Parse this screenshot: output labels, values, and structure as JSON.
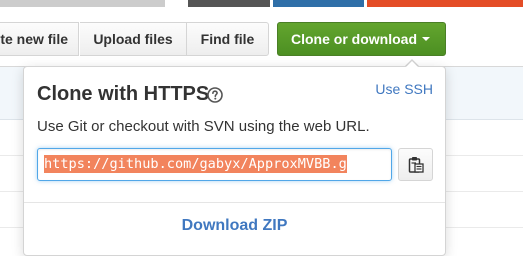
{
  "toolbar": {
    "create_new_file_label": "te new file",
    "upload_files_label": "Upload files",
    "find_file_label": "Find file",
    "clone_or_download_label": "Clone or download"
  },
  "clone_panel": {
    "title": "Clone with HTTPS",
    "help_icon": "question-circle-icon",
    "use_ssh_label": "Use SSH",
    "description": "Use Git or checkout with SVN using the web URL.",
    "url_value": "https://github.com/gabyx/ApproxMVBB.g",
    "copy_icon": "clipboard-icon",
    "download_zip_label": "Download ZIP"
  },
  "colors": {
    "primary_green": "#55a532",
    "link_blue": "#4078c0",
    "selection_orange": "#f2845d",
    "language_bar": [
      "#f1e05a",
      "#f34b7d",
      "#555555",
      "#3572a5",
      "#e34c26",
      "#89e051"
    ]
  }
}
